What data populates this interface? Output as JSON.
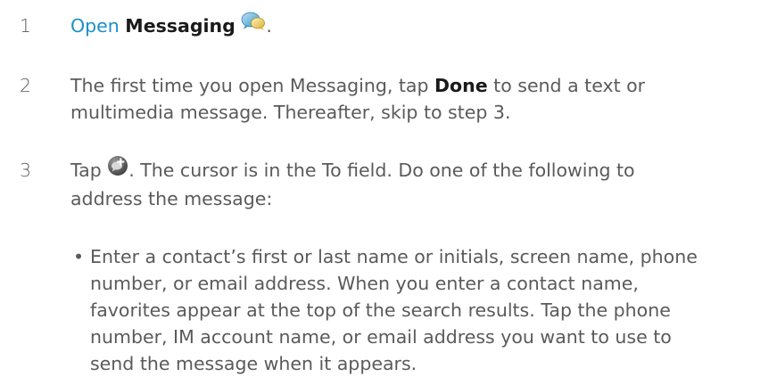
{
  "steps": [
    {
      "number": "1",
      "link_text": "Open",
      "app_name": "Messaging",
      "icon": "messaging-icon",
      "trailing": "."
    },
    {
      "number": "2",
      "pre": "The first time you open Messaging, tap",
      "bold": "Done",
      "post_line1": "to send a text or",
      "line2": "multimedia message. Thereafter, skip to step 3."
    },
    {
      "number": "3",
      "pre": "Tap",
      "icon": "new-message-icon",
      "post_line1": ". The cursor is in the To field. Do one of the following to",
      "line2": "address the message:"
    }
  ],
  "bullet": {
    "symbol": "•",
    "lines": [
      "Enter a contact’s first or last name or initials, screen name, phone",
      "number, or email address. When you enter a contact name,",
      "favorites appear at the top of the search results. Tap the phone",
      "number, IM account name, or email address you want to use to",
      "send the message when it appears."
    ]
  },
  "colors": {
    "link": "#1a8fc6",
    "body_text": "#5a5a5a",
    "bold_text": "#1a1a1a"
  }
}
